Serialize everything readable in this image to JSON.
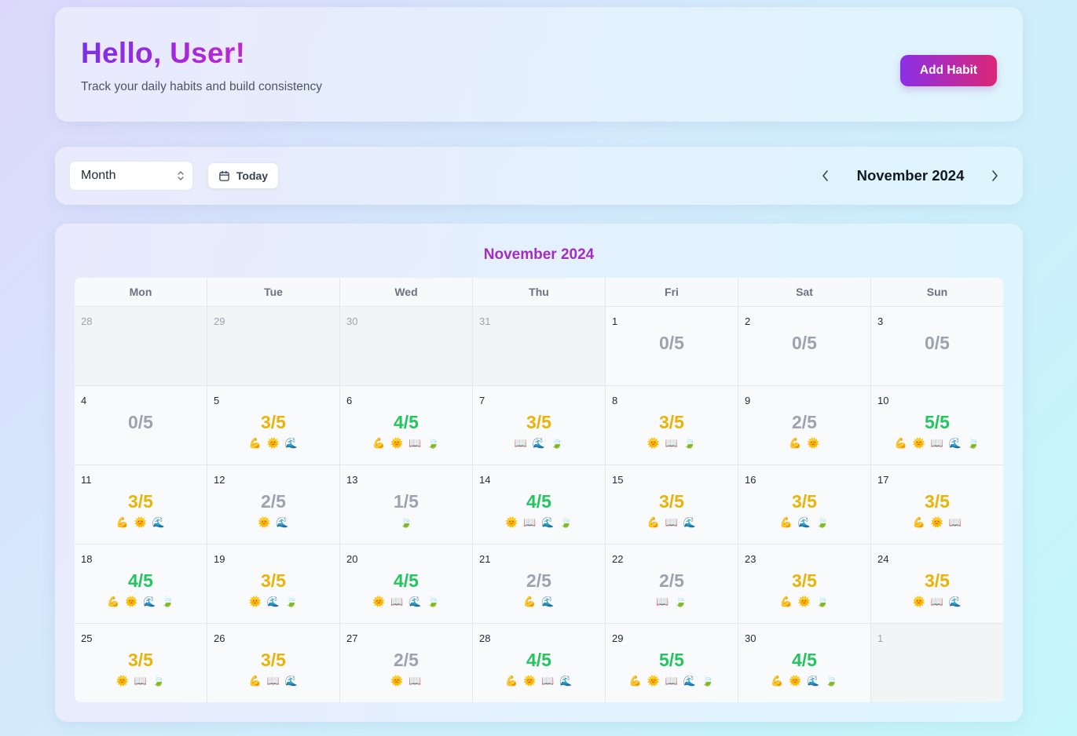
{
  "header": {
    "greeting": "Hello, User!",
    "subtitle": "Track your daily habits and build consistency",
    "add_button": "Add Habit"
  },
  "toolbar": {
    "view_select_value": "Month",
    "today_button": "Today",
    "month_label": "November 2024"
  },
  "calendar": {
    "title": "November 2024",
    "weekdays": [
      "Mon",
      "Tue",
      "Wed",
      "Thu",
      "Fri",
      "Sat",
      "Sun"
    ],
    "habit_icons": {
      "muscle": "💪",
      "sun": "🌞",
      "book": "📖",
      "wave": "🌊",
      "leaf": "🍃"
    },
    "score_colors": {
      "low": "#9ca3af",
      "mid": "#eab308",
      "high": "#22c55e"
    },
    "weeks": [
      [
        {
          "day": "28",
          "other": true
        },
        {
          "day": "29",
          "other": true
        },
        {
          "day": "30",
          "other": true
        },
        {
          "day": "31",
          "other": true
        },
        {
          "day": "1",
          "score": "0/5",
          "level": "low",
          "habits": []
        },
        {
          "day": "2",
          "score": "0/5",
          "level": "low",
          "habits": []
        },
        {
          "day": "3",
          "score": "0/5",
          "level": "low",
          "habits": []
        }
      ],
      [
        {
          "day": "4",
          "score": "0/5",
          "level": "low",
          "habits": []
        },
        {
          "day": "5",
          "score": "3/5",
          "level": "mid",
          "habits": [
            "muscle",
            "sun",
            "wave"
          ]
        },
        {
          "day": "6",
          "score": "4/5",
          "level": "high",
          "habits": [
            "muscle",
            "sun",
            "book",
            "leaf"
          ]
        },
        {
          "day": "7",
          "score": "3/5",
          "level": "mid",
          "habits": [
            "book",
            "wave",
            "leaf"
          ]
        },
        {
          "day": "8",
          "score": "3/5",
          "level": "mid",
          "habits": [
            "sun",
            "book",
            "leaf"
          ]
        },
        {
          "day": "9",
          "score": "2/5",
          "level": "low",
          "habits": [
            "muscle",
            "sun"
          ]
        },
        {
          "day": "10",
          "score": "5/5",
          "level": "high",
          "habits": [
            "muscle",
            "sun",
            "book",
            "wave",
            "leaf"
          ]
        }
      ],
      [
        {
          "day": "11",
          "score": "3/5",
          "level": "mid",
          "habits": [
            "muscle",
            "sun",
            "wave"
          ]
        },
        {
          "day": "12",
          "score": "2/5",
          "level": "low",
          "habits": [
            "sun",
            "wave"
          ]
        },
        {
          "day": "13",
          "score": "1/5",
          "level": "low",
          "habits": [
            "leaf"
          ]
        },
        {
          "day": "14",
          "score": "4/5",
          "level": "high",
          "habits": [
            "sun",
            "book",
            "wave",
            "leaf"
          ]
        },
        {
          "day": "15",
          "score": "3/5",
          "level": "mid",
          "habits": [
            "muscle",
            "book",
            "wave"
          ]
        },
        {
          "day": "16",
          "score": "3/5",
          "level": "mid",
          "habits": [
            "muscle",
            "wave",
            "leaf"
          ]
        },
        {
          "day": "17",
          "score": "3/5",
          "level": "mid",
          "habits": [
            "muscle",
            "sun",
            "book"
          ]
        }
      ],
      [
        {
          "day": "18",
          "score": "4/5",
          "level": "high",
          "habits": [
            "muscle",
            "sun",
            "wave",
            "leaf"
          ]
        },
        {
          "day": "19",
          "score": "3/5",
          "level": "mid",
          "habits": [
            "sun",
            "wave",
            "leaf"
          ]
        },
        {
          "day": "20",
          "score": "4/5",
          "level": "high",
          "habits": [
            "sun",
            "book",
            "wave",
            "leaf"
          ]
        },
        {
          "day": "21",
          "score": "2/5",
          "level": "low",
          "habits": [
            "muscle",
            "wave"
          ]
        },
        {
          "day": "22",
          "score": "2/5",
          "level": "low",
          "habits": [
            "book",
            "leaf"
          ]
        },
        {
          "day": "23",
          "score": "3/5",
          "level": "mid",
          "habits": [
            "muscle",
            "sun",
            "leaf"
          ]
        },
        {
          "day": "24",
          "score": "3/5",
          "level": "mid",
          "habits": [
            "sun",
            "book",
            "wave"
          ]
        }
      ],
      [
        {
          "day": "25",
          "score": "3/5",
          "level": "mid",
          "habits": [
            "sun",
            "book",
            "leaf"
          ]
        },
        {
          "day": "26",
          "score": "3/5",
          "level": "mid",
          "habits": [
            "muscle",
            "book",
            "wave"
          ]
        },
        {
          "day": "27",
          "score": "2/5",
          "level": "low",
          "habits": [
            "sun",
            "book"
          ]
        },
        {
          "day": "28",
          "score": "4/5",
          "level": "high",
          "habits": [
            "muscle",
            "sun",
            "book",
            "wave"
          ]
        },
        {
          "day": "29",
          "score": "5/5",
          "level": "high",
          "habits": [
            "muscle",
            "sun",
            "book",
            "wave",
            "leaf"
          ]
        },
        {
          "day": "30",
          "score": "4/5",
          "level": "high",
          "habits": [
            "muscle",
            "sun",
            "wave",
            "leaf"
          ]
        },
        {
          "day": "1",
          "other": true
        }
      ]
    ]
  }
}
